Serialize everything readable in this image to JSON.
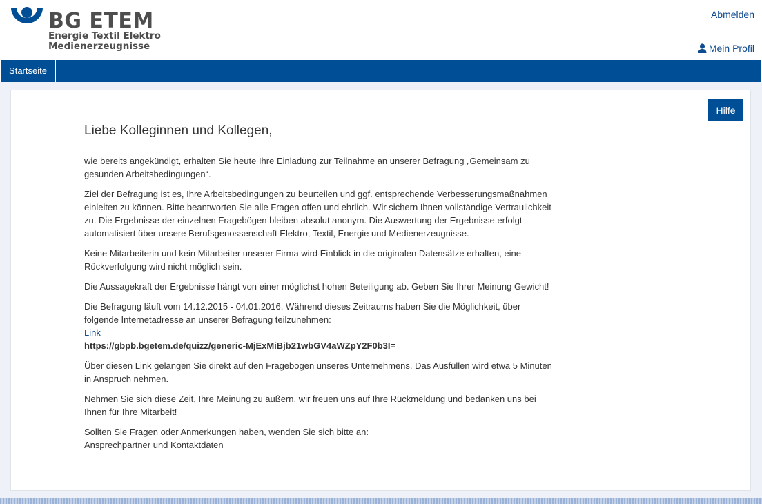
{
  "header": {
    "brand": "BG ETEM",
    "brand_sub_line1": "Energie Textil Elektro",
    "brand_sub_line2": "Medienerzeugnisse",
    "logout_label": "Abmelden",
    "profile_label": "Mein Profil",
    "profile_icon": "user-icon"
  },
  "nav": {
    "items": [
      {
        "label": "Startseite"
      }
    ]
  },
  "help_button": "Hilfe",
  "content": {
    "title": "Liebe Kolleginnen und Kollegen,",
    "p1": "wie bereits angekündigt, erhalten Sie heute Ihre Einladung zur Teilnahme an unserer Befragung „Gemeinsam zu gesunden Arbeitsbedingungen“.",
    "p2": "Ziel der Befragung ist es, Ihre Arbeitsbedingungen zu beurteilen und ggf. entsprechende Verbesserungsmaßnahmen einleiten zu können. Bitte beantworten Sie alle Fragen offen und ehrlich. Wir sichern Ihnen vollständige Vertraulichkeit zu. Die Ergebnisse der einzelnen Fragebögen bleiben absolut anonym. Die Auswertung der Ergebnisse erfolgt automatisiert über unsere Berufsgenossenschaft Elektro, Textil, Energie und Medienerzeugnisse.",
    "p3": "Keine Mitarbeiterin und kein Mitarbeiter unserer Firma wird Einblick in die originalen Datensätze erhalten, eine Rückverfolgung wird nicht möglich sein.",
    "p4": "Die Aussagekraft der Ergebnisse hängt von einer möglichst hohen Beteiligung ab. Geben Sie Ihrer Meinung Gewicht!",
    "p5": "Die Befragung läuft vom 14.12.2015 - 04.01.2016. Während dieses Zeitraums haben Sie die Möglichkeit, über folgende Internetadresse an unserer Befragung teilzunehmen:",
    "link_label": "Link",
    "url": "https://gbpb.bgetem.de/quizz/generic-MjExMiBjb21wbGV4aWZpY2F0b3I=",
    "p6": "Über diesen Link gelangen Sie direkt auf den Fragebogen unseres Unternehmens. Das Ausfüllen wird etwa 5 Minuten in Anspruch nehmen.",
    "p7": "Nehmen Sie sich diese Zeit, Ihre Meinung zu äußern, wir freuen uns auf Ihre Rückmeldung und bedanken uns bei Ihnen für Ihre Mitarbeit!",
    "p8": "Sollten Sie Fragen oder Anmerkungen haben, wenden Sie sich bitte an:",
    "contact": "Ansprechpartner und Kontaktdaten"
  },
  "colors": {
    "primary": "#004f96",
    "link": "#0f4b8f",
    "text": "#333333"
  }
}
